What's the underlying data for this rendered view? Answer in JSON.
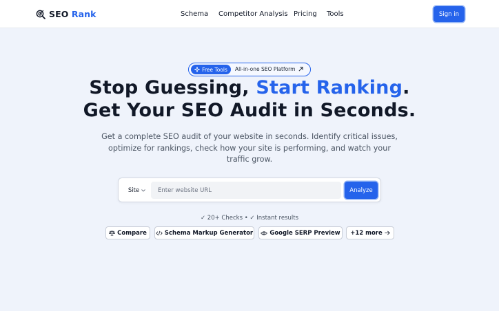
{
  "header": {
    "brand_prefix": "SEO",
    "brand_accent": "Rank",
    "nav": [
      "Schema",
      "Competitor Analysis",
      "Pricing",
      "Tools"
    ],
    "signin_label": "Sign in"
  },
  "badge": {
    "pill_label": "Free Tools",
    "text": "All-in-one SEO Platform"
  },
  "hero": {
    "line1_prefix": "Stop Guessing, ",
    "line1_accent": "Start Ranking",
    "line1_suffix": ".",
    "line2": "Get Your SEO Audit in Seconds.",
    "subtitle": "Get a complete SEO audit of your website in seconds. Identify critical issues, optimize for rankings, check how your site is performing, and watch your traffic grow."
  },
  "search": {
    "scope_value": "Site",
    "url_placeholder": "Enter website URL",
    "url_value": "",
    "submit_label": "Analyze"
  },
  "checks_text": "✓ 20+ Checks • ✓ Instant results",
  "chips": [
    {
      "label": "Compare",
      "icon": "scale-icon"
    },
    {
      "label": "Schema Markup Generator",
      "icon": "code-icon"
    },
    {
      "label": "Google SERP Preview",
      "icon": "eye-icon"
    },
    {
      "label": "+12 more",
      "icon": "arrow-right-icon"
    }
  ],
  "colors": {
    "accent": "#2563eb",
    "background": "#eff3fb",
    "text": "#111827"
  }
}
